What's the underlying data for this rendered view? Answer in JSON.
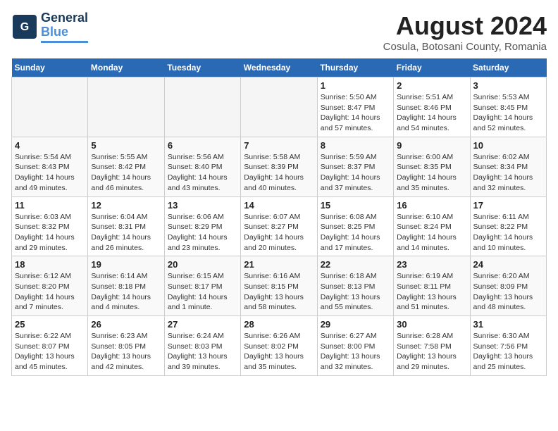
{
  "logo": {
    "line1": "General",
    "line2": "Blue"
  },
  "title": "August 2024",
  "location": "Cosula, Botosani County, Romania",
  "weekdays": [
    "Sunday",
    "Monday",
    "Tuesday",
    "Wednesday",
    "Thursday",
    "Friday",
    "Saturday"
  ],
  "weeks": [
    [
      {
        "day": "",
        "info": ""
      },
      {
        "day": "",
        "info": ""
      },
      {
        "day": "",
        "info": ""
      },
      {
        "day": "",
        "info": ""
      },
      {
        "day": "1",
        "info": "Sunrise: 5:50 AM\nSunset: 8:47 PM\nDaylight: 14 hours\nand 57 minutes."
      },
      {
        "day": "2",
        "info": "Sunrise: 5:51 AM\nSunset: 8:46 PM\nDaylight: 14 hours\nand 54 minutes."
      },
      {
        "day": "3",
        "info": "Sunrise: 5:53 AM\nSunset: 8:45 PM\nDaylight: 14 hours\nand 52 minutes."
      }
    ],
    [
      {
        "day": "4",
        "info": "Sunrise: 5:54 AM\nSunset: 8:43 PM\nDaylight: 14 hours\nand 49 minutes."
      },
      {
        "day": "5",
        "info": "Sunrise: 5:55 AM\nSunset: 8:42 PM\nDaylight: 14 hours\nand 46 minutes."
      },
      {
        "day": "6",
        "info": "Sunrise: 5:56 AM\nSunset: 8:40 PM\nDaylight: 14 hours\nand 43 minutes."
      },
      {
        "day": "7",
        "info": "Sunrise: 5:58 AM\nSunset: 8:39 PM\nDaylight: 14 hours\nand 40 minutes."
      },
      {
        "day": "8",
        "info": "Sunrise: 5:59 AM\nSunset: 8:37 PM\nDaylight: 14 hours\nand 37 minutes."
      },
      {
        "day": "9",
        "info": "Sunrise: 6:00 AM\nSunset: 8:35 PM\nDaylight: 14 hours\nand 35 minutes."
      },
      {
        "day": "10",
        "info": "Sunrise: 6:02 AM\nSunset: 8:34 PM\nDaylight: 14 hours\nand 32 minutes."
      }
    ],
    [
      {
        "day": "11",
        "info": "Sunrise: 6:03 AM\nSunset: 8:32 PM\nDaylight: 14 hours\nand 29 minutes."
      },
      {
        "day": "12",
        "info": "Sunrise: 6:04 AM\nSunset: 8:31 PM\nDaylight: 14 hours\nand 26 minutes."
      },
      {
        "day": "13",
        "info": "Sunrise: 6:06 AM\nSunset: 8:29 PM\nDaylight: 14 hours\nand 23 minutes."
      },
      {
        "day": "14",
        "info": "Sunrise: 6:07 AM\nSunset: 8:27 PM\nDaylight: 14 hours\nand 20 minutes."
      },
      {
        "day": "15",
        "info": "Sunrise: 6:08 AM\nSunset: 8:25 PM\nDaylight: 14 hours\nand 17 minutes."
      },
      {
        "day": "16",
        "info": "Sunrise: 6:10 AM\nSunset: 8:24 PM\nDaylight: 14 hours\nand 14 minutes."
      },
      {
        "day": "17",
        "info": "Sunrise: 6:11 AM\nSunset: 8:22 PM\nDaylight: 14 hours\nand 10 minutes."
      }
    ],
    [
      {
        "day": "18",
        "info": "Sunrise: 6:12 AM\nSunset: 8:20 PM\nDaylight: 14 hours\nand 7 minutes."
      },
      {
        "day": "19",
        "info": "Sunrise: 6:14 AM\nSunset: 8:18 PM\nDaylight: 14 hours\nand 4 minutes."
      },
      {
        "day": "20",
        "info": "Sunrise: 6:15 AM\nSunset: 8:17 PM\nDaylight: 14 hours\nand 1 minute."
      },
      {
        "day": "21",
        "info": "Sunrise: 6:16 AM\nSunset: 8:15 PM\nDaylight: 13 hours\nand 58 minutes."
      },
      {
        "day": "22",
        "info": "Sunrise: 6:18 AM\nSunset: 8:13 PM\nDaylight: 13 hours\nand 55 minutes."
      },
      {
        "day": "23",
        "info": "Sunrise: 6:19 AM\nSunset: 8:11 PM\nDaylight: 13 hours\nand 51 minutes."
      },
      {
        "day": "24",
        "info": "Sunrise: 6:20 AM\nSunset: 8:09 PM\nDaylight: 13 hours\nand 48 minutes."
      }
    ],
    [
      {
        "day": "25",
        "info": "Sunrise: 6:22 AM\nSunset: 8:07 PM\nDaylight: 13 hours\nand 45 minutes."
      },
      {
        "day": "26",
        "info": "Sunrise: 6:23 AM\nSunset: 8:05 PM\nDaylight: 13 hours\nand 42 minutes."
      },
      {
        "day": "27",
        "info": "Sunrise: 6:24 AM\nSunset: 8:03 PM\nDaylight: 13 hours\nand 39 minutes."
      },
      {
        "day": "28",
        "info": "Sunrise: 6:26 AM\nSunset: 8:02 PM\nDaylight: 13 hours\nand 35 minutes."
      },
      {
        "day": "29",
        "info": "Sunrise: 6:27 AM\nSunset: 8:00 PM\nDaylight: 13 hours\nand 32 minutes."
      },
      {
        "day": "30",
        "info": "Sunrise: 6:28 AM\nSunset: 7:58 PM\nDaylight: 13 hours\nand 29 minutes."
      },
      {
        "day": "31",
        "info": "Sunrise: 6:30 AM\nSunset: 7:56 PM\nDaylight: 13 hours\nand 25 minutes."
      }
    ]
  ]
}
